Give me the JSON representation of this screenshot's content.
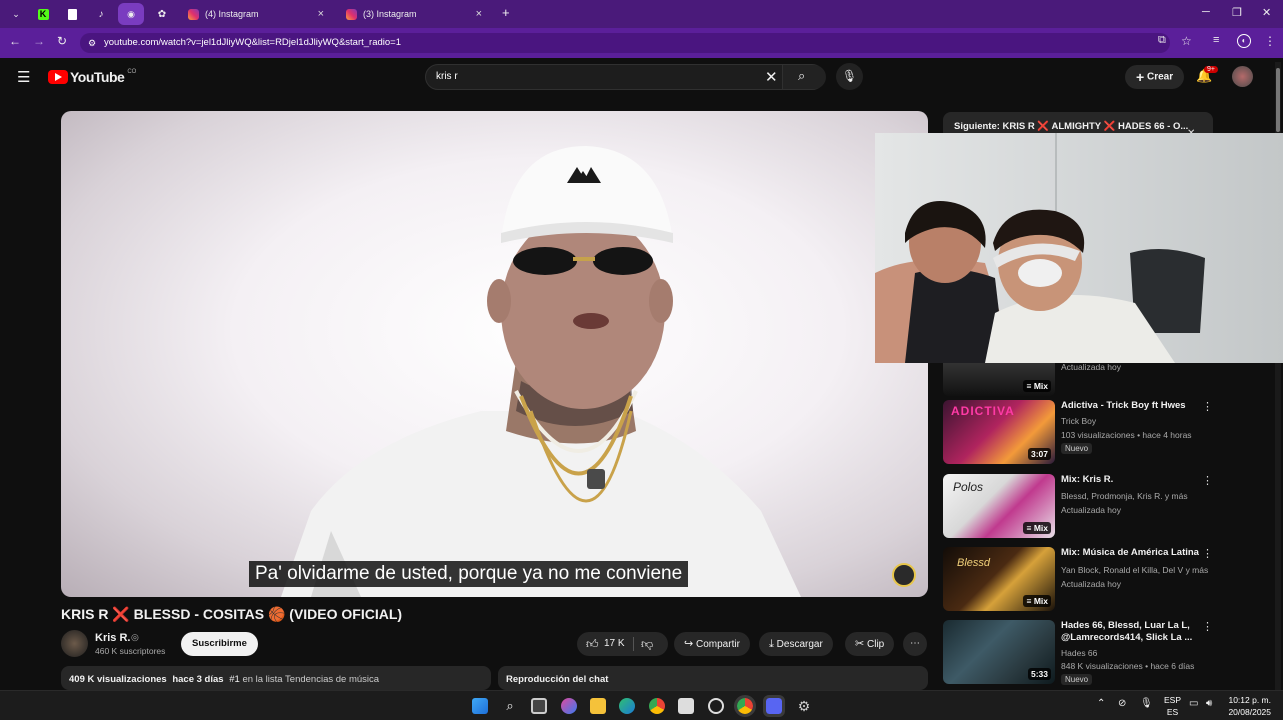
{
  "browser": {
    "tabs": [
      {
        "title": "(4) Instagram"
      },
      {
        "title": "(3) Instagram"
      }
    ],
    "url": "youtube.com/watch?v=jel1dJliyWQ&list=RDjel1dJliyWQ&start_radio=1",
    "new_tab": "+"
  },
  "youtube": {
    "logo_text": "YouTube",
    "country_code": "CO",
    "search_value": "kris r",
    "create_label": "Crear",
    "notif_badge": "9+"
  },
  "video": {
    "caption": "Pa' olvidarme de usted, porque ya no me conviene",
    "title": "KRIS R ❌ BLESSD - COSITAS 🏀 (VIDEO OFICIAL)",
    "channel": "Kris R.",
    "subscribers": "460 K suscriptores",
    "subscribe_label": "Suscribirme",
    "likes": "17 K",
    "share_label": "Compartir",
    "download_label": "Descargar",
    "clip_label": "Clip",
    "views": "409 K visualizaciones",
    "age": "hace 3 días",
    "rank": "#1",
    "trending": "en la lista Tendencias de música",
    "chat_replay": "Reproducción del chat"
  },
  "sidebar": {
    "next_up": "Siguiente: KRIS R ❌ ALMIGHTY ❌ HADES 66 - O...",
    "partial_meta": "Actualizada hoy",
    "partial_badge": "Mix",
    "items": [
      {
        "title": "Adictiva - Trick Boy ft Hwes",
        "channel": "Trick Boy",
        "meta": "103 visualizaciones • hace 4 horas",
        "badge": "Nuevo",
        "duration": "3:07",
        "thumb_text": "ADICTIVA"
      },
      {
        "title": "Mix: Kris R.",
        "channel": "Blessd, Prodmonja, Kris R. y más",
        "meta": "Actualizada hoy",
        "badge": "",
        "duration": "Mix",
        "thumb_text": "Polos"
      },
      {
        "title": "Mix: Música de América Latina",
        "channel": "Yan Block, Ronald el Killa, Del V y más",
        "meta": "Actualizada hoy",
        "badge": "",
        "duration": "Mix",
        "thumb_text": "Blessd"
      },
      {
        "title": "Hades 66, Blessd, Luar La L, @Lamrecords414, Slick La ...",
        "channel": "Hades 66",
        "meta": "848 K visualizaciones • hace 6 días",
        "badge": "Nuevo",
        "duration": "5:33",
        "thumb_text": ""
      }
    ]
  },
  "taskbar": {
    "lang_top": "ESP",
    "lang_bottom": "ES",
    "time": "10:12 p. m.",
    "date": "20/08/2025"
  },
  "colors": {
    "tabbar": "#4a1a7a",
    "addrbar": "#5b1f9a",
    "yt_red": "#ff0000",
    "bg": "#0f0f0f"
  }
}
